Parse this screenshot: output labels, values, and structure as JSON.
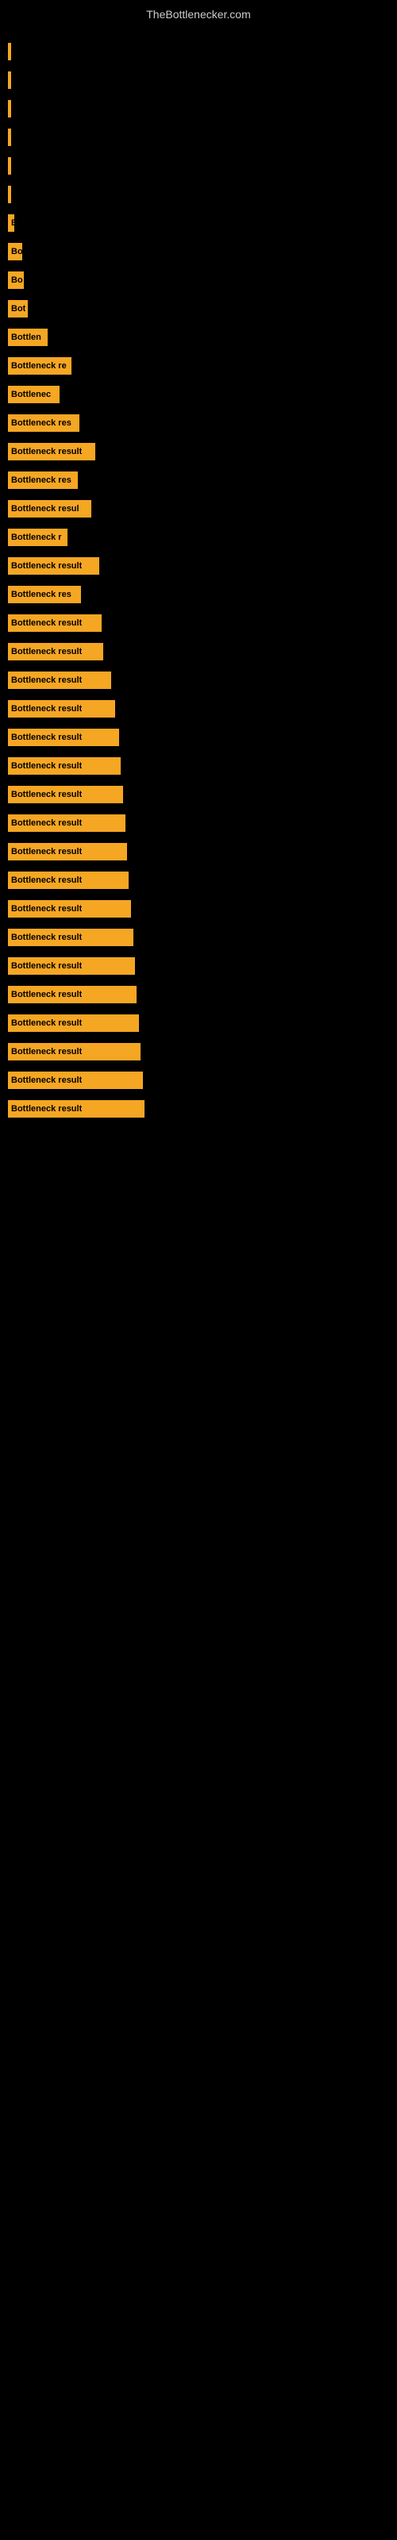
{
  "site": {
    "title": "TheBottlenecker.com"
  },
  "bars": [
    {
      "label": "",
      "width": 2
    },
    {
      "label": "",
      "width": 2
    },
    {
      "label": "",
      "width": 3
    },
    {
      "label": "",
      "width": 2
    },
    {
      "label": "",
      "width": 2
    },
    {
      "label": "",
      "width": 3
    },
    {
      "label": "B",
      "width": 8
    },
    {
      "label": "Bo",
      "width": 18
    },
    {
      "label": "Bo",
      "width": 20
    },
    {
      "label": "Bot",
      "width": 25
    },
    {
      "label": "Bottlen",
      "width": 50
    },
    {
      "label": "Bottleneck re",
      "width": 80
    },
    {
      "label": "Bottlenec",
      "width": 65
    },
    {
      "label": "Bottleneck res",
      "width": 90
    },
    {
      "label": "Bottleneck result",
      "width": 110
    },
    {
      "label": "Bottleneck res",
      "width": 88
    },
    {
      "label": "Bottleneck resul",
      "width": 105
    },
    {
      "label": "Bottleneck r",
      "width": 75
    },
    {
      "label": "Bottleneck result",
      "width": 115
    },
    {
      "label": "Bottleneck res",
      "width": 92
    },
    {
      "label": "Bottleneck result",
      "width": 118
    },
    {
      "label": "Bottleneck result",
      "width": 120
    },
    {
      "label": "Bottleneck result",
      "width": 130
    },
    {
      "label": "Bottleneck result",
      "width": 135
    },
    {
      "label": "Bottleneck result",
      "width": 140
    },
    {
      "label": "Bottleneck result",
      "width": 142
    },
    {
      "label": "Bottleneck result",
      "width": 145
    },
    {
      "label": "Bottleneck result",
      "width": 148
    },
    {
      "label": "Bottleneck result",
      "width": 150
    },
    {
      "label": "Bottleneck result",
      "width": 152
    },
    {
      "label": "Bottleneck result",
      "width": 155
    },
    {
      "label": "Bottleneck result",
      "width": 158
    },
    {
      "label": "Bottleneck result",
      "width": 160
    },
    {
      "label": "Bottleneck result",
      "width": 162
    },
    {
      "label": "Bottleneck result",
      "width": 165
    },
    {
      "label": "Bottleneck result",
      "width": 167
    },
    {
      "label": "Bottleneck result",
      "width": 170
    },
    {
      "label": "Bottleneck result",
      "width": 172
    }
  ]
}
